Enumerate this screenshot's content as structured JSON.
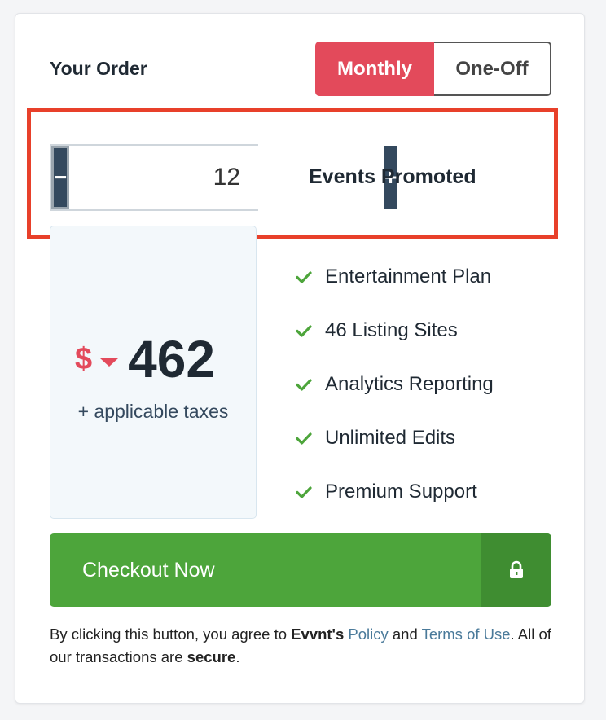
{
  "order": {
    "title": "Your Order",
    "toggle": {
      "monthly": "Monthly",
      "one_off": "One-Off",
      "selected": "Monthly"
    }
  },
  "colors": {
    "accent": "#e34a5b",
    "highlight": "#e8402a",
    "stepper": "#34495e",
    "checkout": "#4da53b",
    "checkout_lock": "#3f8d31",
    "check": "#4da53b"
  },
  "stepper": {
    "minus": "−",
    "value": "12",
    "plus": "+",
    "label": "Events Promoted"
  },
  "price": {
    "currency": "$",
    "amount": "462",
    "taxes": "+ applicable taxes"
  },
  "features": [
    {
      "icon": "check-icon",
      "text": "Entertainment Plan"
    },
    {
      "icon": "check-icon",
      "text": "46 Listing Sites"
    },
    {
      "icon": "check-icon",
      "text": "Analytics Reporting"
    },
    {
      "icon": "check-icon",
      "text": "Unlimited Edits"
    },
    {
      "icon": "check-icon",
      "text": "Premium Support"
    }
  ],
  "checkout": {
    "label": "Checkout Now",
    "icon": "lock-icon"
  },
  "disclaimer": {
    "t1": "By clicking this button, you agree to ",
    "brand": "Evvnt's",
    "t2": " ",
    "policy": "Policy",
    "t3": " and ",
    "terms": "Terms of Use",
    "t4": ". All of our transactions are ",
    "secure": "secure",
    "t5": "."
  }
}
